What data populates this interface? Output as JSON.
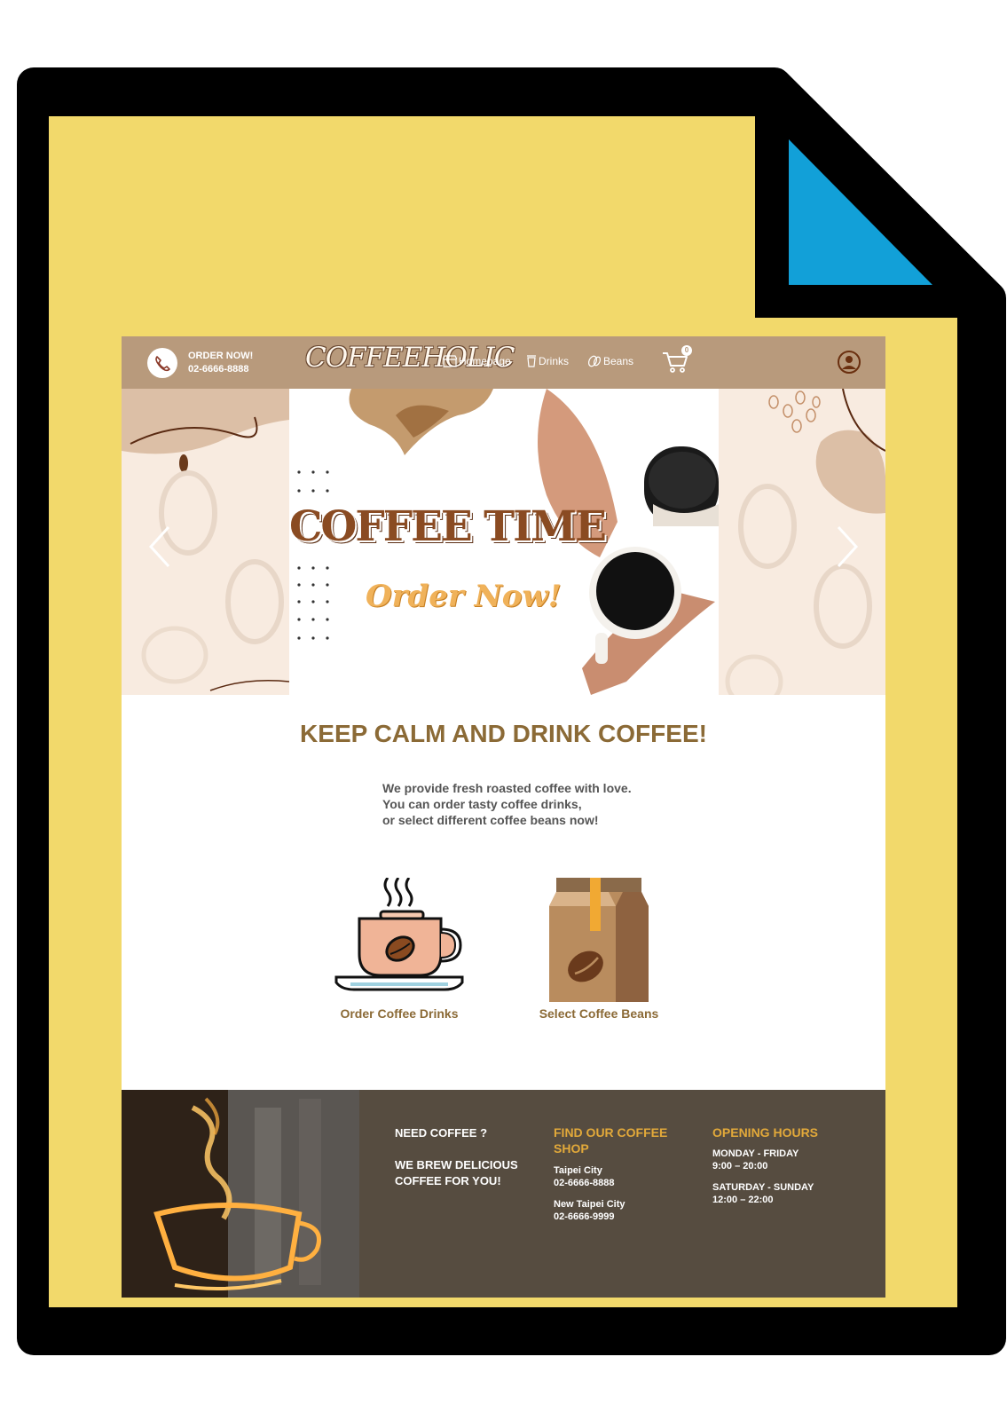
{
  "nav": {
    "order_label": "ORDER NOW!",
    "phone": "02-6666-8888",
    "logo": "COFFEEHOLIC",
    "links": [
      {
        "label": "Homepage",
        "icon": "shop-icon"
      },
      {
        "label": "Drinks",
        "icon": "cup-icon"
      },
      {
        "label": "Beans",
        "icon": "bean-icon"
      }
    ],
    "cart_count": "0"
  },
  "hero": {
    "title": "COFFEE TIME",
    "subtitle": "Order Now!"
  },
  "intro": {
    "headline": "KEEP CALM AND DRINK COFFEE!",
    "lines": [
      "We provide fresh roasted coffee with love.",
      "You can order tasty coffee drinks,",
      "or select different coffee beans now!"
    ]
  },
  "features": [
    {
      "label": "Order Coffee Drinks",
      "icon": "coffee-cup-icon"
    },
    {
      "label": "Select Coffee Beans",
      "icon": "coffee-bag-icon"
    }
  ],
  "footer": {
    "need": "NEED COFFEE ?",
    "brew": [
      "WE BREW DELICIOUS",
      "COFFEE FOR YOU!"
    ],
    "find_title": [
      "FIND OUR COFFEE",
      "SHOP"
    ],
    "shops": [
      {
        "city": "Taipei City",
        "phone": "02-6666-8888"
      },
      {
        "city": "New Taipei City",
        "phone": "02-6666-9999"
      }
    ],
    "hours_title": "OPENING HOURS",
    "hours": [
      {
        "days": "MONDAY - FRIDAY",
        "time": "9:00 – 20:00"
      },
      {
        "days": "SATURDAY - SUNDAY",
        "time": "12:00 – 22:00"
      }
    ]
  },
  "colors": {
    "page_yellow": "#f2d96b",
    "corner_blue": "#12a0d8",
    "nav_tan": "#b89a7c",
    "headline_brown": "#8b6a36",
    "footer_bg": "#564c40",
    "footer_gold": "#e2a93a"
  }
}
